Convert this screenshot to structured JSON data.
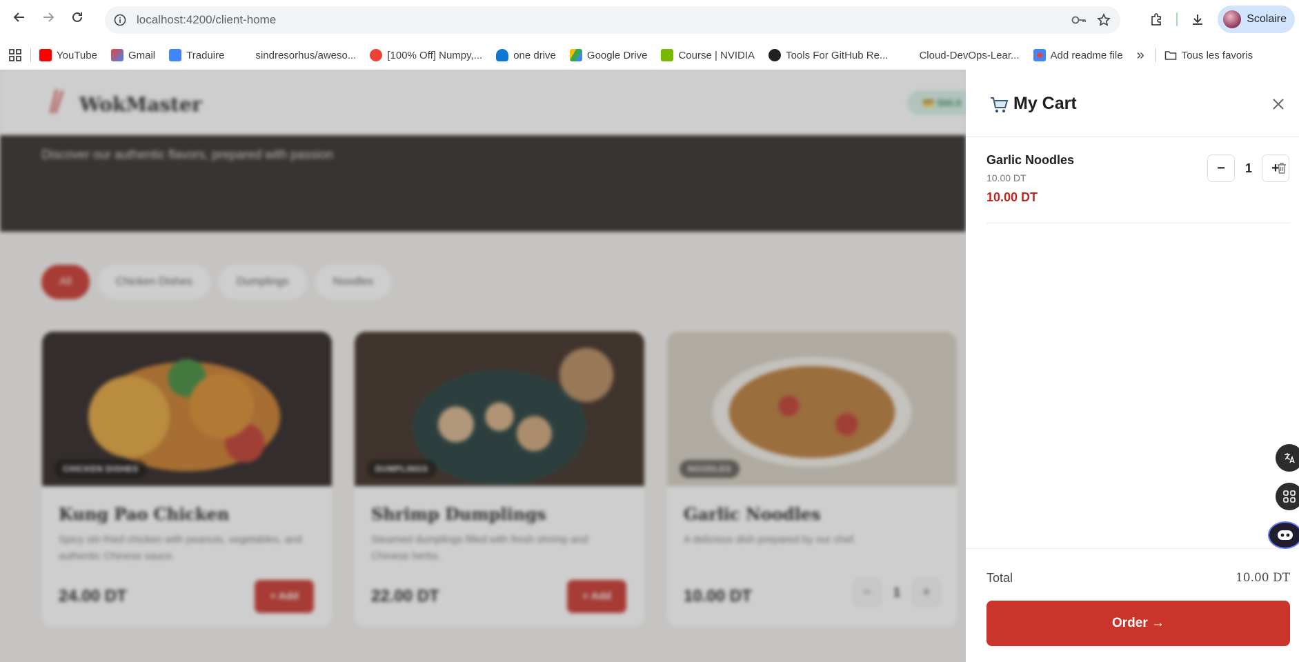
{
  "browser": {
    "url": "localhost:4200/client-home",
    "profile_name": "Scolaire",
    "bookmarks": [
      {
        "label": "YouTube",
        "color": "#ff0000"
      },
      {
        "label": "Gmail",
        "color": "#ea4335"
      },
      {
        "label": "Traduire",
        "color": "#4285f4"
      },
      {
        "label": "sindresorhus/aweso...",
        "color": "#ffffff"
      },
      {
        "label": "[100% Off] Numpy,...",
        "color": "#ea4335"
      },
      {
        "label": "one drive",
        "color": "#0f78d4"
      },
      {
        "label": "Google Drive",
        "color": "#34a853"
      },
      {
        "label": "Course | NVIDIA",
        "color": "#76b900"
      },
      {
        "label": "Tools For GitHub Re...",
        "color": "#202124"
      },
      {
        "label": "Cloud-DevOps-Lear...",
        "color": "#ffffff"
      },
      {
        "label": "Add readme file",
        "color": "#4285f4"
      }
    ],
    "bookmarks_overflow": "»",
    "other_bookmarks": "Tous les favoris"
  },
  "site": {
    "brand": "WokMaster",
    "balance": "💳 500.0",
    "hero_subtitle": "Discover our authentic flavors, prepared with passion",
    "filters": [
      "All",
      "Chicken Dishes",
      "Dumplings",
      "Noodles"
    ],
    "products": [
      {
        "badge": "Chicken Dishes",
        "name": "Kung Pao Chicken",
        "description": "Spicy stir-fried chicken with peanuts, vegetables, and authentic Chinese sauce.",
        "price": "24.00 DT",
        "add_label": "+ Add"
      },
      {
        "badge": "Dumplings",
        "name": "Shrimp Dumplings",
        "description": "Steamed dumplings filled with fresh shrimp and Chinese herbs.",
        "price": "22.00 DT",
        "add_label": "+ Add"
      },
      {
        "badge": "Noodles",
        "name": "Garlic Noodles",
        "description": "A delicious dish prepared by our chef.",
        "price": "10.00 DT",
        "qty": "1",
        "minus": "−",
        "plus": "+"
      }
    ]
  },
  "cart": {
    "title": "My Cart",
    "items": [
      {
        "name": "Garlic Noodles",
        "unit_price": "10.00 DT",
        "line_total": "10.00 DT",
        "qty": "1",
        "minus": "−",
        "plus": "+"
      }
    ],
    "total_label": "Total",
    "total_value": "10.00 DT",
    "order_label": "Order →"
  },
  "colors": {
    "accent": "#c9342b",
    "price_red": "#c0281f"
  }
}
